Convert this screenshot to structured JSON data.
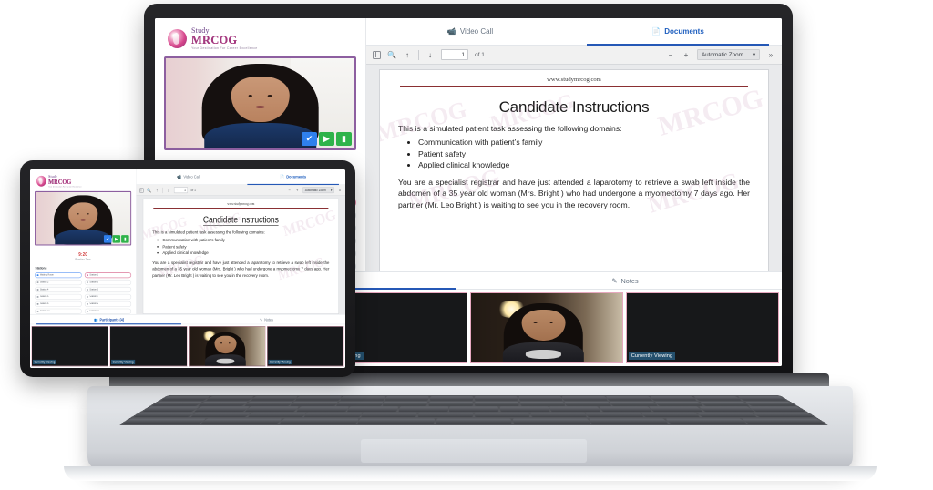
{
  "brand": {
    "name_line1": "Study",
    "name_line2": "MRCOG",
    "tagline": "Your Destination For Career Excellence"
  },
  "video": {
    "controls": [
      {
        "name": "accept",
        "glyph": "✔",
        "color": "#2f80ed"
      },
      {
        "name": "camera",
        "glyph": "▶",
        "color": "#2eb34a"
      },
      {
        "name": "microphone",
        "glyph": "▮",
        "color": "#2eb34a"
      }
    ]
  },
  "timer": {
    "value": "9:20",
    "label": "Reading Time"
  },
  "stations": {
    "title": "Stations",
    "items": [
      {
        "label": "Waiting Room",
        "state": "active-room"
      },
      {
        "label": "Station 1",
        "state": "active-station"
      },
      {
        "label": "Station 2",
        "state": ""
      },
      {
        "label": "Station 3",
        "state": ""
      },
      {
        "label": "Station 4",
        "state": ""
      },
      {
        "label": "Station 5",
        "state": ""
      },
      {
        "label": "Station 6",
        "state": ""
      },
      {
        "label": "Station 7",
        "state": ""
      },
      {
        "label": "Station 8",
        "state": ""
      },
      {
        "label": "Station 9",
        "state": ""
      },
      {
        "label": "Station 10",
        "state": ""
      },
      {
        "label": "Station 11",
        "state": ""
      }
    ]
  },
  "tabs": [
    {
      "label": "Video Call",
      "icon": "📹",
      "active": false
    },
    {
      "label": "Documents",
      "icon": "📄",
      "active": true
    }
  ],
  "pdf_toolbar": {
    "sidebar_toggle": "sidebar-toggle",
    "search_icon": "🔍",
    "prev_icon": "↑",
    "next_icon": "↓",
    "page_value": "1",
    "page_total": "of 1",
    "zoom_out": "−",
    "zoom_in": "+",
    "zoom_level": "Automatic Zoom",
    "zoom_caret": "▾",
    "more_tools": "»"
  },
  "document": {
    "url": "www.studymrcog.com",
    "title": "Candidate Instructions",
    "lead": "This is a simulated patient task assessing the following domains:",
    "domains": [
      "Communication with patient’s family",
      "Patient safety",
      "Applied clinical knowledge"
    ],
    "paragraph": "You are a specialist registrar and have just attended a laparotomy to retrieve a swab left inside the abdomen of a 35 year old woman (Mrs. Bright ) who had undergone a myomectomy 7 days ago. Her partner (Mr. Leo Bright ) is waiting to see you in the recovery room.",
    "watermark": "MRCOG"
  },
  "participants": {
    "tabs": [
      {
        "label": "Participants (4)",
        "icon": "👥",
        "active": true
      },
      {
        "label": "Notes",
        "icon": "✎",
        "active": false
      }
    ],
    "tiles": [
      {
        "badge": "Currently Viewing",
        "has_video": false
      },
      {
        "badge": "Currently Viewing",
        "has_video": false
      },
      {
        "badge": "",
        "has_video": true
      },
      {
        "badge": "Currently Viewing",
        "has_video": false
      }
    ]
  },
  "colors": {
    "accent_blue": "#2558b6",
    "brand_pink": "#d6468c",
    "brand_purple": "#8d5fa0",
    "tile_border": "#e7a8bf",
    "badge_bg": "#24506e",
    "doc_rule": "#8a2f32"
  }
}
